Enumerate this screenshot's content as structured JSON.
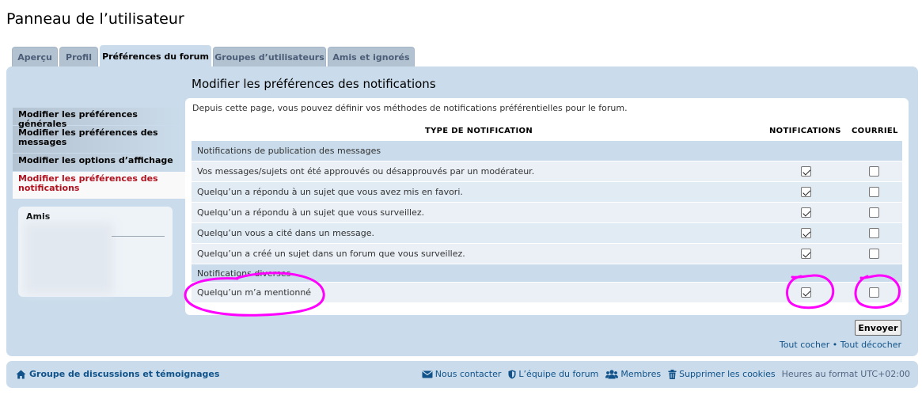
{
  "page": {
    "title": "Panneau de l’utilisateur"
  },
  "tabs": [
    {
      "label": "Aperçu"
    },
    {
      "label": "Profil"
    },
    {
      "label": "Préférences du forum",
      "active": true
    },
    {
      "label": "Groupes d’utilisateurs"
    },
    {
      "label": "Amis et ignorés"
    }
  ],
  "sidebar": {
    "items": [
      {
        "label": "Modifier les préférences générales"
      },
      {
        "label": "Modifier les préférences des messages"
      },
      {
        "label": "Modifier les options d’affichage"
      },
      {
        "label": "Modifier les préférences des notifications",
        "active": true
      }
    ],
    "friends_label": "Amis"
  },
  "main": {
    "title": "Modifier les préférences des notifications",
    "intro": "Depuis cette page, vous pouvez définir vos méthodes de notifications préférentielles pour le forum.",
    "columns": {
      "type": "TYPE DE NOTIFICATION",
      "notifications": "NOTIFICATIONS",
      "email": "COURRIEL"
    },
    "groups": [
      {
        "label": "Notifications de publication des messages",
        "rows": [
          {
            "label": "Vos messages/sujets ont été approuvés ou désapprouvés par un modérateur.",
            "notifications": true,
            "email": false
          },
          {
            "label": "Quelqu’un a répondu à un sujet que vous avez mis en favori.",
            "notifications": true,
            "email": false
          },
          {
            "label": "Quelqu’un a répondu à un sujet que vous surveillez.",
            "notifications": true,
            "email": false
          },
          {
            "label": "Quelqu’un vous a cité dans un message.",
            "notifications": true,
            "email": false
          },
          {
            "label": "Quelqu’un a créé un sujet dans un forum que vous surveillez.",
            "notifications": true,
            "email": false
          }
        ]
      },
      {
        "label": "Notifications diverses",
        "rows": [
          {
            "label": "Quelqu’un m’a mentionné",
            "notifications": true,
            "email": false
          }
        ]
      }
    ],
    "submit_label": "Envoyer",
    "check_all": "Tout cocher",
    "separator": "•",
    "uncheck_all": "Tout décocher"
  },
  "footer": {
    "board_link": "Groupe de discussions et témoignages",
    "contact": "Nous contacter",
    "team": "L’équipe du forum",
    "members": "Membres",
    "delete_cookies": "Supprimer les cookies",
    "timezone": "Heures au format UTC+02:00",
    "link_color": "#105289"
  },
  "colors": {
    "panel_bg": "#cadceb",
    "active_menu_text": "#b0121f",
    "annotation": "#ff00ff"
  }
}
